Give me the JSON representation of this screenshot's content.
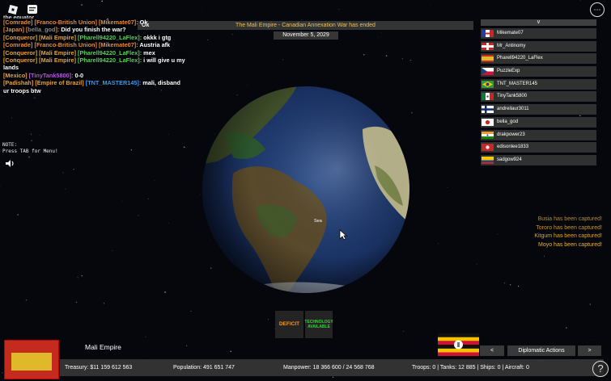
{
  "chat": {
    "cut_line": "the equator",
    "lines": [
      [
        {
          "t": "[Comrade] [Franco-British Union] [Mikemate07]:",
          "c": "#e88b3a"
        },
        {
          "t": " Ok",
          "c": "#fff"
        }
      ],
      [
        {
          "t": "[Japan] [",
          "c": "#e88b3a"
        },
        {
          "t": "bella_god",
          "c": "#888"
        },
        {
          "t": "]:",
          "c": "#e88b3a"
        },
        {
          "t": " Did you finish the war?",
          "c": "#fff"
        }
      ],
      [
        {
          "t": "[Conqueror] [Mali Empire] ",
          "c": "#e8a23a"
        },
        {
          "t": "[Pharell94220_LaFlex]:",
          "c": "#5bd15b"
        },
        {
          "t": "  okkk i gtg",
          "c": "#fff"
        }
      ],
      [
        {
          "t": "[Comrade] [Franco-British Union] [Mikemate07]:",
          "c": "#e88b3a"
        },
        {
          "t": "  Austria afk",
          "c": "#fff"
        }
      ],
      [
        {
          "t": "[Conqueror] [Mali Empire] ",
          "c": "#e8a23a"
        },
        {
          "t": "[Pharell94220_LaFlex]:",
          "c": "#5bd15b"
        },
        {
          "t": "  mex",
          "c": "#fff"
        }
      ],
      [
        {
          "t": "[Conqueror] [Mali Empire] ",
          "c": "#e8a23a"
        },
        {
          "t": "[Pharell94220_LaFlex]:",
          "c": "#5bd15b"
        },
        {
          "t": "  i will give u my lands",
          "c": "#fff"
        }
      ],
      [
        {
          "t": "[Mexico] ",
          "c": "#e8a23a"
        },
        {
          "t": "[TinyTank5800]:",
          "c": "#b05bd1"
        },
        {
          "t": "  0-0",
          "c": "#fff"
        }
      ],
      [
        {
          "t": "[Padishah] [Empire of Brazil] ",
          "c": "#e8a23a"
        },
        {
          "t": "[TNT_MASTER145]:",
          "c": "#3a9be8"
        },
        {
          "t": "  mali, disband ur troops btw",
          "c": "#fff"
        }
      ]
    ]
  },
  "notification": {
    "ok": "Ok",
    "text": "The Mali Empire - Canadian Annexation War has ended"
  },
  "date": "November 5, 2029",
  "player_list": {
    "toggle": "v",
    "players": [
      {
        "name": "Mikemate07",
        "flag": "franco-british"
      },
      {
        "name": "Mr_Antinomy",
        "flag": "georgia-red"
      },
      {
        "name": "Pharell94220_LaFlex",
        "flag": "mali-empire"
      },
      {
        "name": "PuzzleExp",
        "flag": "czech"
      },
      {
        "name": "TNT_MASTER145",
        "flag": "brazil"
      },
      {
        "name": "TinyTank5800",
        "flag": "mexico"
      },
      {
        "name": "andreilaur3011",
        "flag": "finland"
      },
      {
        "name": "bella_god",
        "flag": "japan"
      },
      {
        "name": "drakpower23",
        "flag": "india"
      },
      {
        "name": "edisonlee1833",
        "flag": "red-emblem"
      },
      {
        "name": "sadgow924",
        "flag": "colombia"
      }
    ]
  },
  "note": {
    "line1": "NOTE:",
    "line2": "Press TAB for Menu!"
  },
  "globe_label": "Sea",
  "captures": [
    {
      "text": "Busia has been captured!",
      "c": "#b08a3a"
    },
    {
      "text": "Tororo has been captured!",
      "c": "#c9962a"
    },
    {
      "text": "Kitgum has been captured!",
      "c": "#e8a323"
    },
    {
      "text": "Moyo has been captured!",
      "c": "#f2b12a"
    }
  ],
  "buttons": {
    "deficit": "DEFICIT",
    "technology": "TECHNOLOGY AVAILABLE",
    "prev": "<",
    "diplomatic": "Diplomatic Actions",
    "next": ">",
    "help": "?"
  },
  "country": {
    "name": "Mali Empire"
  },
  "stats": {
    "treasury_label": "Treasury:",
    "treasury": "$11 159 612 563",
    "population_label": "Population:",
    "population": "491 651 747",
    "manpower_label": "Manpower:",
    "manpower": "18 366 600  /  24 568 768",
    "troops": "Troops: 0",
    "tanks": "Tanks: 12 885",
    "ships": "Ships: 0",
    "aircraft": "Aircraft: 0",
    "sep": "|"
  },
  "colors": {
    "accent": "#f2c14e",
    "deficit": "#f29a1d",
    "tech": "#3ad13a"
  }
}
